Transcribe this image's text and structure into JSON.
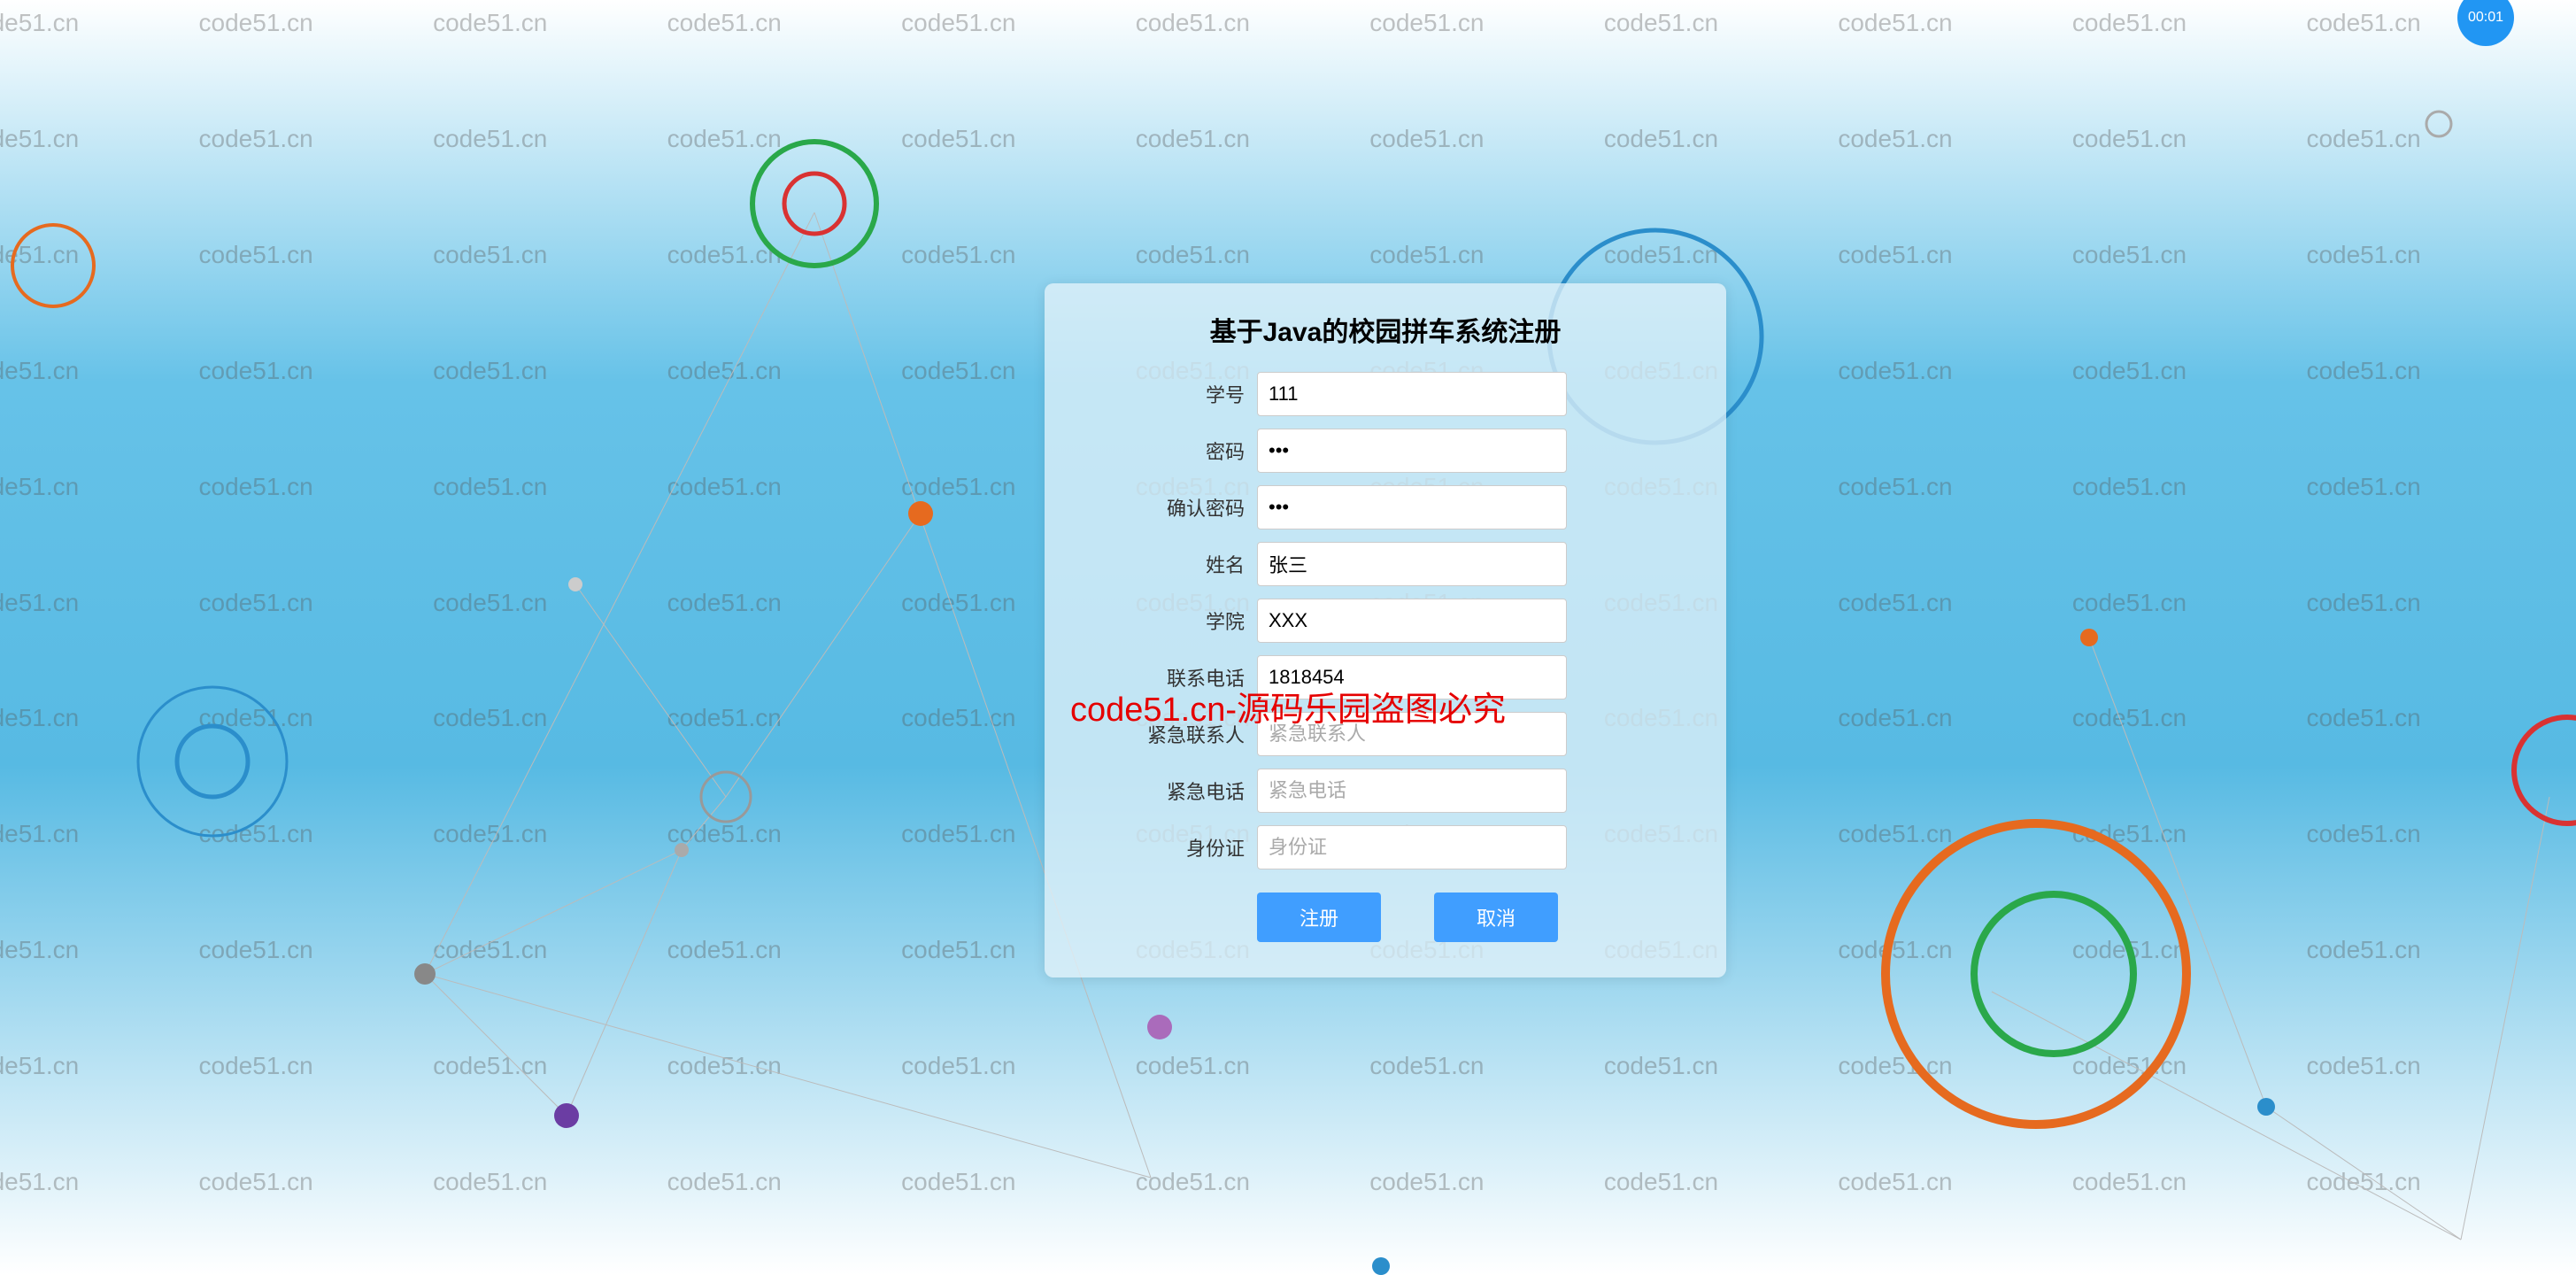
{
  "form": {
    "title": "基于Java的校园拼车系统注册",
    "fields": {
      "student_id": {
        "label": "学号",
        "value": "111",
        "placeholder": ""
      },
      "password": {
        "label": "密码",
        "value": "•••",
        "placeholder": ""
      },
      "confirm_password": {
        "label": "确认密码",
        "value": "•••",
        "placeholder": ""
      },
      "name": {
        "label": "姓名",
        "value": "张三",
        "placeholder": ""
      },
      "college": {
        "label": "学院",
        "value": "XXX",
        "placeholder": ""
      },
      "phone": {
        "label": "联系电话",
        "value": "1818454",
        "placeholder": ""
      },
      "emergency_contact": {
        "label": "紧急联系人",
        "value": "",
        "placeholder": "紧急联系人"
      },
      "emergency_phone": {
        "label": "紧急电话",
        "value": "",
        "placeholder": "紧急电话"
      },
      "id_card": {
        "label": "身份证",
        "value": "",
        "placeholder": "身份证"
      }
    },
    "buttons": {
      "submit": "注册",
      "cancel": "取消"
    }
  },
  "watermark_text": "code51.cn",
  "center_warning": "code51.cn-源码乐园盗图必究",
  "badge_text": "00:01"
}
